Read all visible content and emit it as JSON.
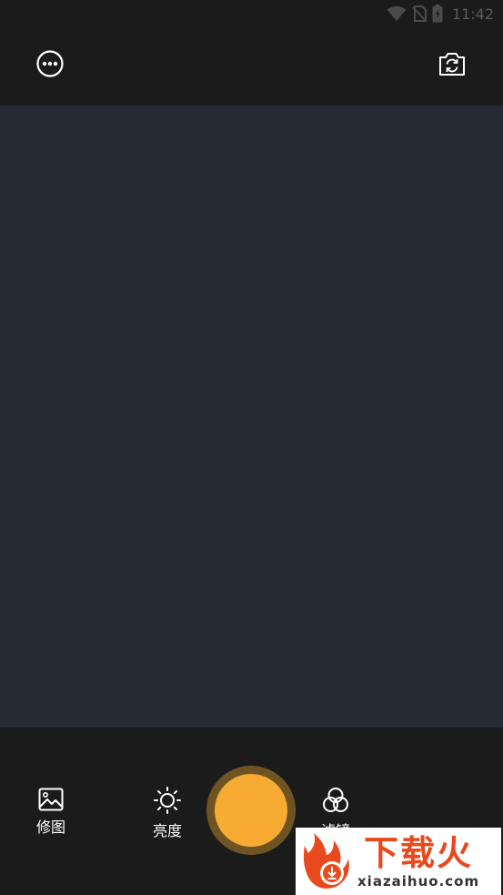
{
  "status_bar": {
    "time": "11:42",
    "icons": [
      "wifi-icon",
      "no-sim-icon",
      "battery-icon"
    ]
  },
  "top_bar": {
    "left_icon": "more-icon",
    "right_icon": "camera-switch-icon"
  },
  "tools": {
    "edit": {
      "label": "修图",
      "icon": "image-icon"
    },
    "brightness": {
      "label": "亮度",
      "icon": "sun-icon"
    },
    "filter": {
      "label": "滤镜",
      "icon": "filter-icon"
    }
  },
  "shutter": {
    "icon": "shutter-button",
    "color": "#f7ab33",
    "ring_color": "#6f5423"
  },
  "watermark": {
    "cn": "下载火",
    "en": "xiazaihuo.com"
  },
  "colors": {
    "preview_bg": "#262b33",
    "bar_bg": "#1b1b1b",
    "accent": "#f7ab33"
  }
}
